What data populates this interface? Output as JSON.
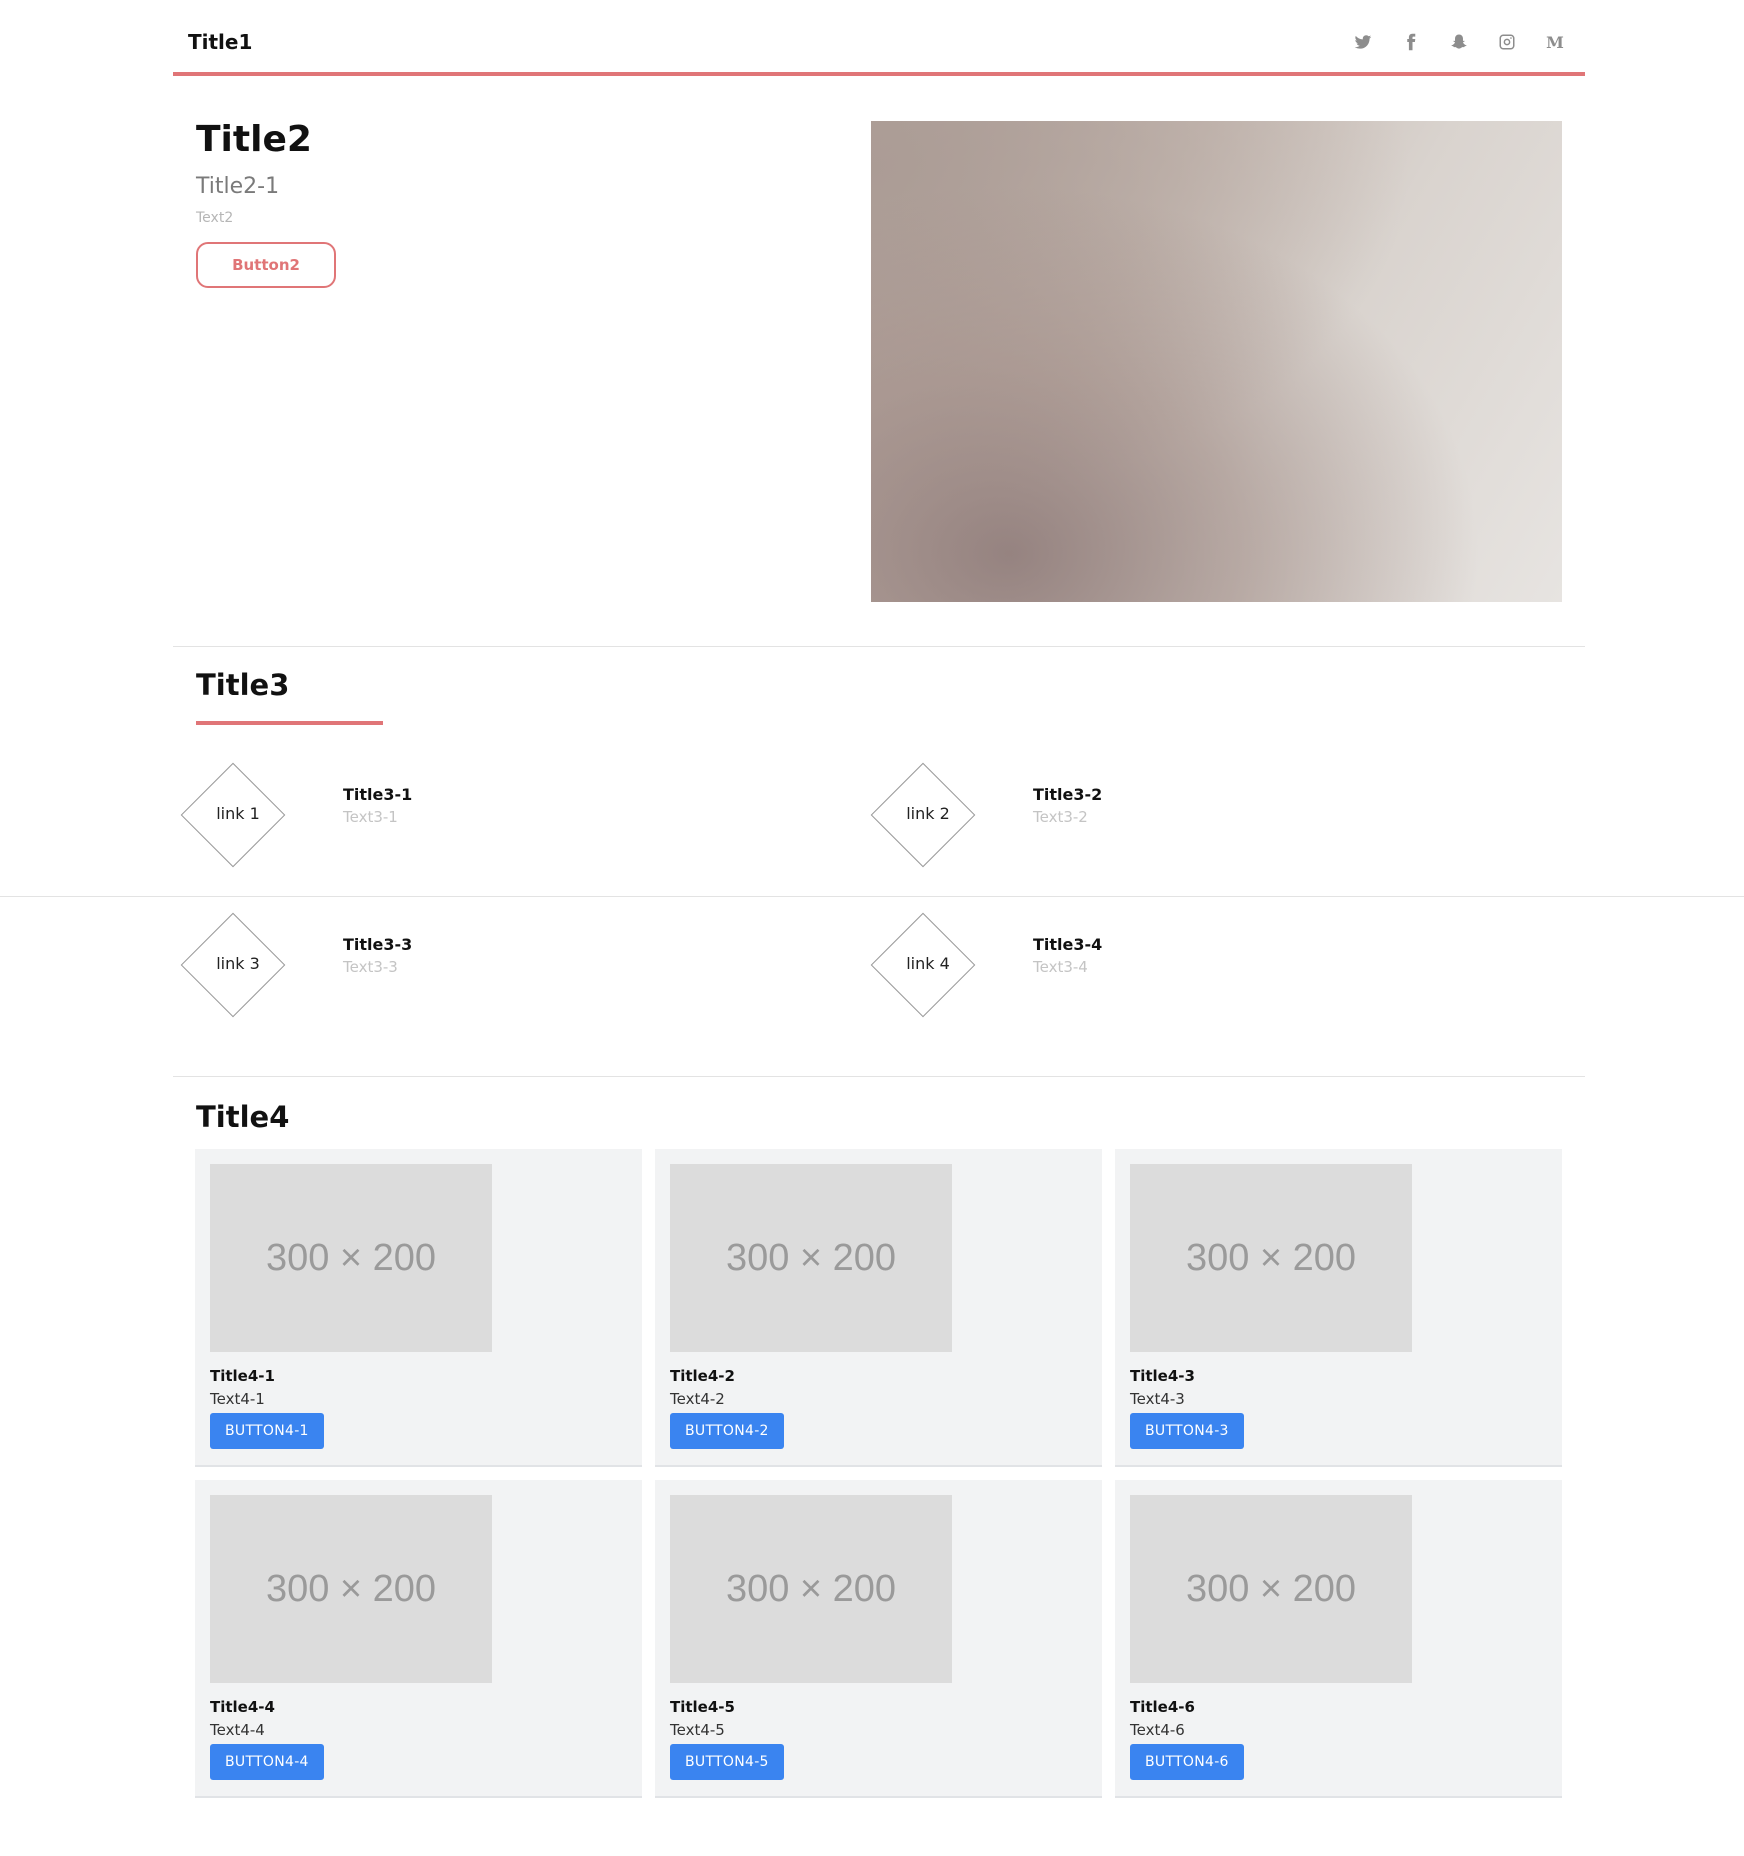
{
  "header": {
    "title": "Title1",
    "social_icons": [
      "twitter-icon",
      "facebook-icon",
      "snapchat-icon",
      "instagram-icon",
      "medium-icon"
    ],
    "medium_glyph": "M",
    "accent_color": "#e07577"
  },
  "hero": {
    "title": "Title2",
    "subtitle": "Title2-1",
    "text": "Text2",
    "button": "Button2"
  },
  "features": {
    "title": "Title3",
    "items": [
      {
        "link": "link 1",
        "title": "Title3-1",
        "text": "Text3-1"
      },
      {
        "link": "link 2",
        "title": "Title3-2",
        "text": "Text3-2"
      },
      {
        "link": "link 3",
        "title": "Title3-3",
        "text": "Text3-3"
      },
      {
        "link": "link 4",
        "title": "Title3-4",
        "text": "Text3-4"
      }
    ]
  },
  "cards": {
    "title": "Title4",
    "placeholder": "300 × 200",
    "button_color": "#3a84f0",
    "items": [
      {
        "title": "Title4-1",
        "text": "Text4-1",
        "button": "BUTTON4-1"
      },
      {
        "title": "Title4-2",
        "text": "Text4-2",
        "button": "BUTTON4-2"
      },
      {
        "title": "Title4-3",
        "text": "Text4-3",
        "button": "BUTTON4-3"
      },
      {
        "title": "Title4-4",
        "text": "Text4-4",
        "button": "BUTTON4-4"
      },
      {
        "title": "Title4-5",
        "text": "Text4-5",
        "button": "BUTTON4-5"
      },
      {
        "title": "Title4-6",
        "text": "Text4-6",
        "button": "BUTTON4-6"
      }
    ]
  }
}
